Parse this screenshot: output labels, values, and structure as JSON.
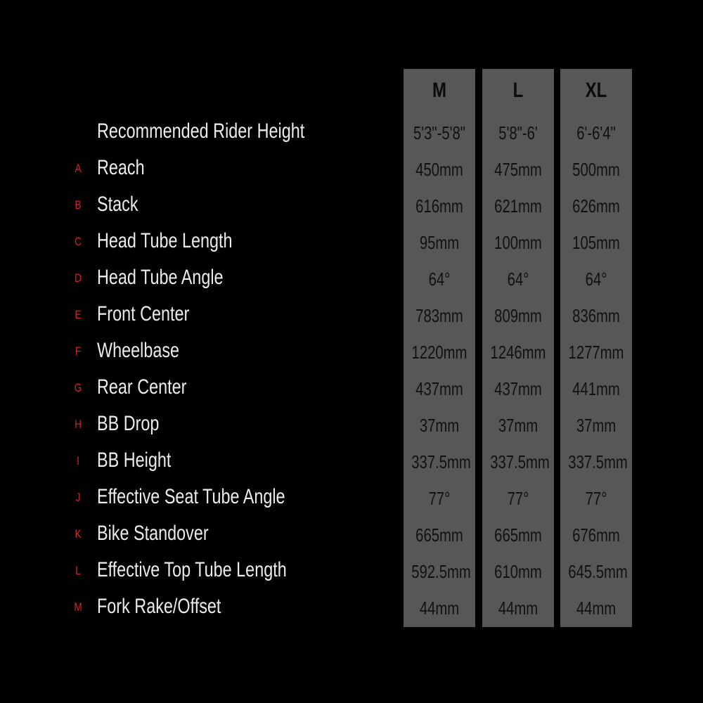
{
  "sizes": [
    "M",
    "L",
    "XL"
  ],
  "colors": {
    "background": "#000000",
    "column": "#575757",
    "letter": "#d3262b",
    "label": "#ececec"
  },
  "rows": [
    {
      "letter": "",
      "label": "Recommended Rider Height",
      "values": [
        "5'3\"-5'8\"",
        "5'8\"-6'",
        "6'-6'4\""
      ]
    },
    {
      "letter": "A",
      "label": "Reach",
      "values": [
        "450mm",
        "475mm",
        "500mm"
      ]
    },
    {
      "letter": "B",
      "label": "Stack",
      "values": [
        "616mm",
        "621mm",
        "626mm"
      ]
    },
    {
      "letter": "C",
      "label": "Head Tube Length",
      "values": [
        "95mm",
        "100mm",
        "105mm"
      ]
    },
    {
      "letter": "D",
      "label": "Head Tube Angle",
      "values": [
        "64°",
        "64°",
        "64°"
      ]
    },
    {
      "letter": "E",
      "label": "Front Center",
      "values": [
        "783mm",
        "809mm",
        "836mm"
      ]
    },
    {
      "letter": "F",
      "label": "Wheelbase",
      "values": [
        "1220mm",
        "1246mm",
        "1277mm"
      ]
    },
    {
      "letter": "G",
      "label": "Rear Center",
      "values": [
        "437mm",
        "437mm",
        "441mm"
      ]
    },
    {
      "letter": "H",
      "label": "BB Drop",
      "values": [
        "37mm",
        "37mm",
        "37mm"
      ]
    },
    {
      "letter": "I",
      "label": "BB Height",
      "values": [
        "337.5mm",
        "337.5mm",
        "337.5mm"
      ]
    },
    {
      "letter": "J",
      "label": "Effective Seat Tube Angle",
      "values": [
        "77°",
        "77°",
        "77°"
      ]
    },
    {
      "letter": "K",
      "label": "Bike Standover",
      "values": [
        "665mm",
        "665mm",
        "676mm"
      ]
    },
    {
      "letter": "L",
      "label": "Effective Top Tube Length",
      "values": [
        "592.5mm",
        "610mm",
        "645.5mm"
      ]
    },
    {
      "letter": "M",
      "label": "Fork Rake/Offset",
      "values": [
        "44mm",
        "44mm",
        "44mm"
      ]
    }
  ]
}
